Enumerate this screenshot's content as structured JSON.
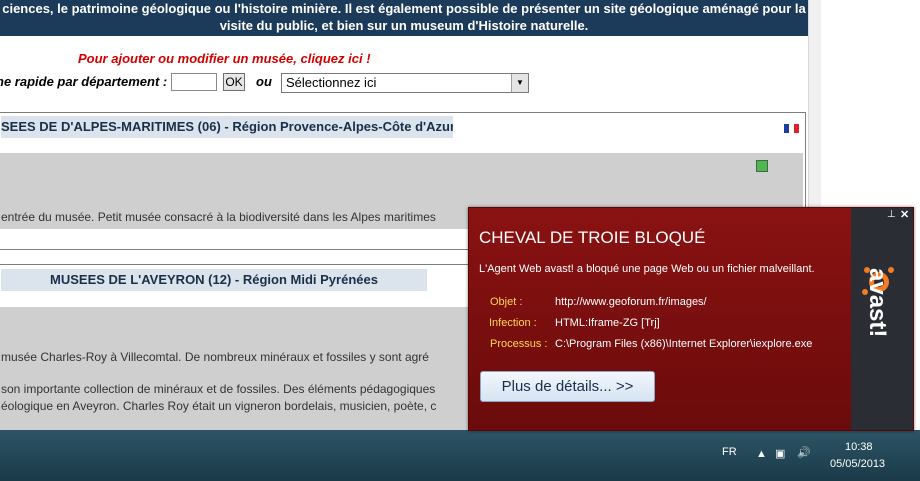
{
  "page": {
    "banner_line1": "ciences, le patrimoine géologique ou l'histoire minière. Il est également possible de présenter un site géologique aménagé pour la",
    "banner_line2": "visite du public, et bien sur un museum d'Histoire naturelle.",
    "add_link": "Pour ajouter ou modifier un musée, cliquez ici !",
    "quick_search_label": "ne rapide par département :",
    "dept_input_value": "",
    "ok_button": "OK",
    "or_label": "ou",
    "select_value": "Sélectionnez ici"
  },
  "sections": [
    {
      "heading": "SEES DE D'ALPES-MARITIMES (06) - Région Provence-Alpes-Côte d'Azur",
      "text1": "entrée du musée. Petit musée consacré à la biodiversité dans les Alpes maritimes"
    },
    {
      "heading": "MUSEES DE L'AVEYRON (12) - Région Midi Pyrénées",
      "text1": "musée Charles-Roy à Villecomtal. De nombreux minéraux et fossiles y sont agré",
      "text2": "son importante collection de minéraux et de fossiles. Des éléments pédagogiques",
      "text3": "éologique en Aveyron. Charles Roy était un vigneron bordelais, musicien, poète, c"
    }
  ],
  "popup": {
    "title": "CHEVAL DE TROIE BLOQUÉ",
    "message": "L'Agent Web avast! a bloqué une page Web ou un fichier malveillant.",
    "object_label": "Objet :",
    "object_value": "http://www.geoforum.fr/images/",
    "infection_label": "Infection :",
    "infection_value": "HTML:Iframe-ZG [Trj]",
    "process_label": "Processus :",
    "process_value": "C:\\Program Files (x86)\\Internet Explorer\\iexplore.exe",
    "details_button": "Plus de détails... >>",
    "brand": "avast!"
  },
  "taskbar": {
    "language": "FR",
    "time": "10:38",
    "date": "05/05/2013"
  },
  "colors": {
    "banner": "#1c3a5a",
    "link_red": "#d40000",
    "popup_red": "#7a0e0e",
    "avast_orange": "#f47b20"
  }
}
